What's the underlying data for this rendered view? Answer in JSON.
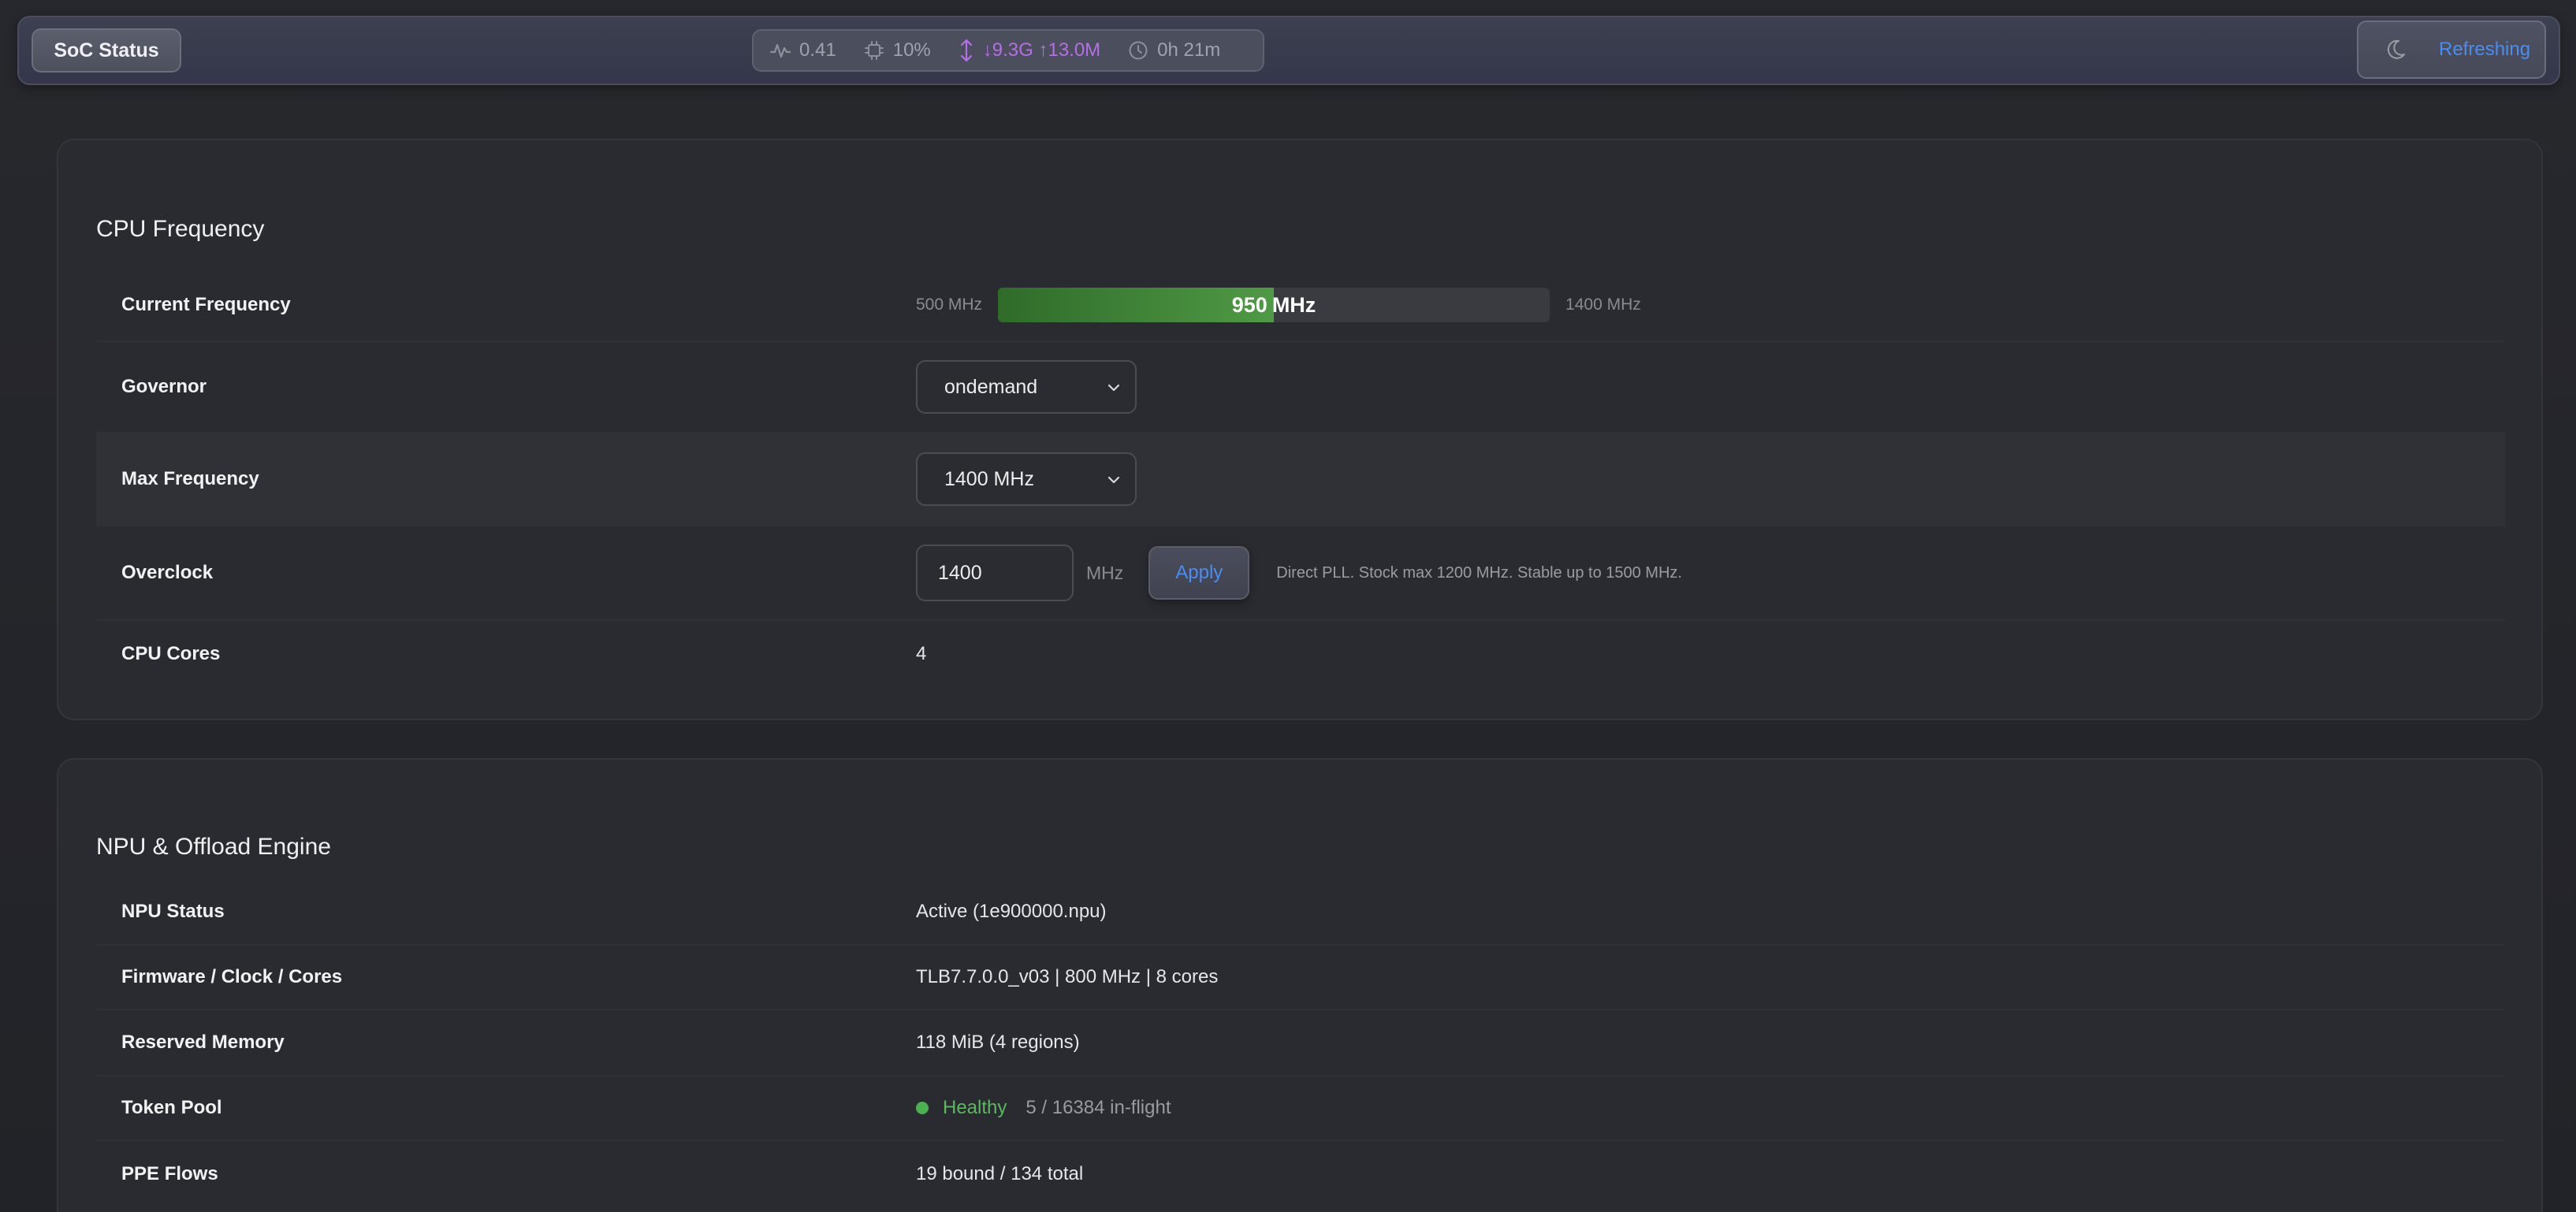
{
  "topbar": {
    "soc_button": "SoC Status",
    "stats": {
      "load": "0.41",
      "cpu": "10%",
      "net": "↓9.3G ↑13.0M",
      "uptime": "0h 21m"
    },
    "refresh_label": "Refreshing",
    "colors": {
      "accent": "#4a8df0",
      "net": "#b56fe6"
    }
  },
  "cpu_card": {
    "title": "CPU Frequency",
    "current_frequency": {
      "label": "Current Frequency",
      "min_label": "500 MHz",
      "max_label": "1400 MHz",
      "value": "950",
      "unit": "MHz",
      "min_value": 500,
      "max_value": 1400,
      "current_value": 950
    },
    "governor": {
      "label": "Governor",
      "selected": "ondemand"
    },
    "max_frequency": {
      "label": "Max Frequency",
      "selected": "1400 MHz"
    },
    "overclock": {
      "label": "Overclock",
      "value": "1400",
      "unit": "MHz",
      "apply_label": "Apply",
      "note": "Direct PLL. Stock max 1200 MHz. Stable up to 1500 MHz."
    },
    "cores": {
      "label": "CPU Cores",
      "value": "4"
    }
  },
  "npu_card": {
    "title": "NPU & Offload Engine",
    "rows": [
      {
        "label": "NPU Status",
        "value": "Active (1e900000.npu)"
      },
      {
        "label": "Firmware / Clock / Cores",
        "value": "TLB7.7.0.0_v03 | 800 MHz | 8 cores"
      },
      {
        "label": "Reserved Memory",
        "value": "118 MiB (4 regions)"
      }
    ],
    "token_pool": {
      "label": "Token Pool",
      "status": "Healthy",
      "detail": "5 / 16384 in-flight",
      "status_color": "#5cb85c"
    },
    "ppe_flows": {
      "label": "PPE Flows",
      "value": "19 bound / 134 total"
    }
  }
}
